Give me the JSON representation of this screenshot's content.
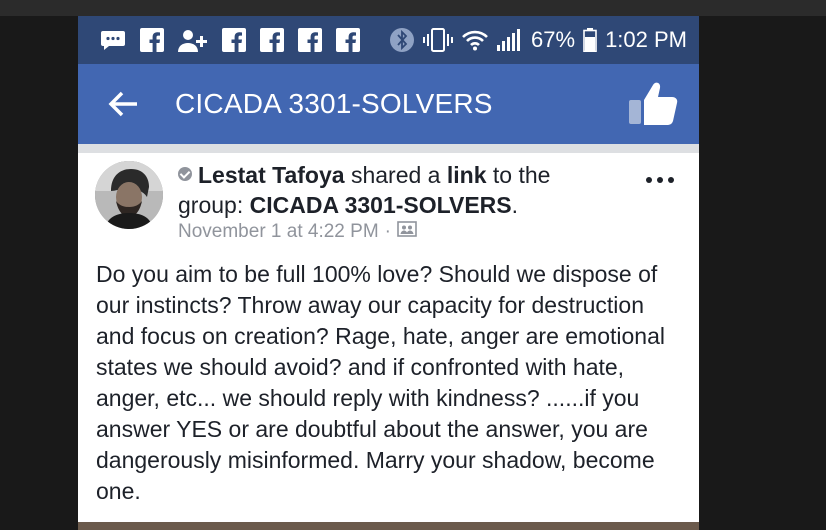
{
  "status_bar": {
    "left_icons": [
      "messenger-icon",
      "facebook-icon",
      "add-friend-icon",
      "facebook-icon",
      "facebook-icon",
      "facebook-icon",
      "facebook-icon"
    ],
    "right_icons": [
      "bluetooth-icon",
      "vibrate-icon",
      "wifi-icon",
      "signal-icon",
      "battery-icon"
    ],
    "battery": "67%",
    "time": "1:02 PM"
  },
  "app_bar": {
    "title": "CICADA 3301-SOLVERS"
  },
  "post": {
    "author": "Lestat Tafoya",
    "shared_a": "shared a",
    "link_word": "link",
    "to_the": "to the",
    "group_prefix": "group:",
    "group_name": "CICADA 3301-SOLVERS",
    "period": ".",
    "timestamp": "November 1 at 4:22 PM",
    "separator": "·",
    "audience_icon": "group-audience-icon",
    "body": "Do you aim to be full 100% love? Should we dispose of our instincts? Throw away our capacity for destruction and focus on creation? Rage, hate, anger are emotional states we should avoid? and if confronted with hate, anger, etc... we should reply with kindness? ......if you answer YES or are doubtful about the answer, you are dangerously misinformed. Marry your shadow, become one."
  },
  "colors": {
    "status_bar": "#2f4876",
    "app_bar": "#4267b2",
    "text": "#1d2129",
    "meta": "#90949c"
  }
}
